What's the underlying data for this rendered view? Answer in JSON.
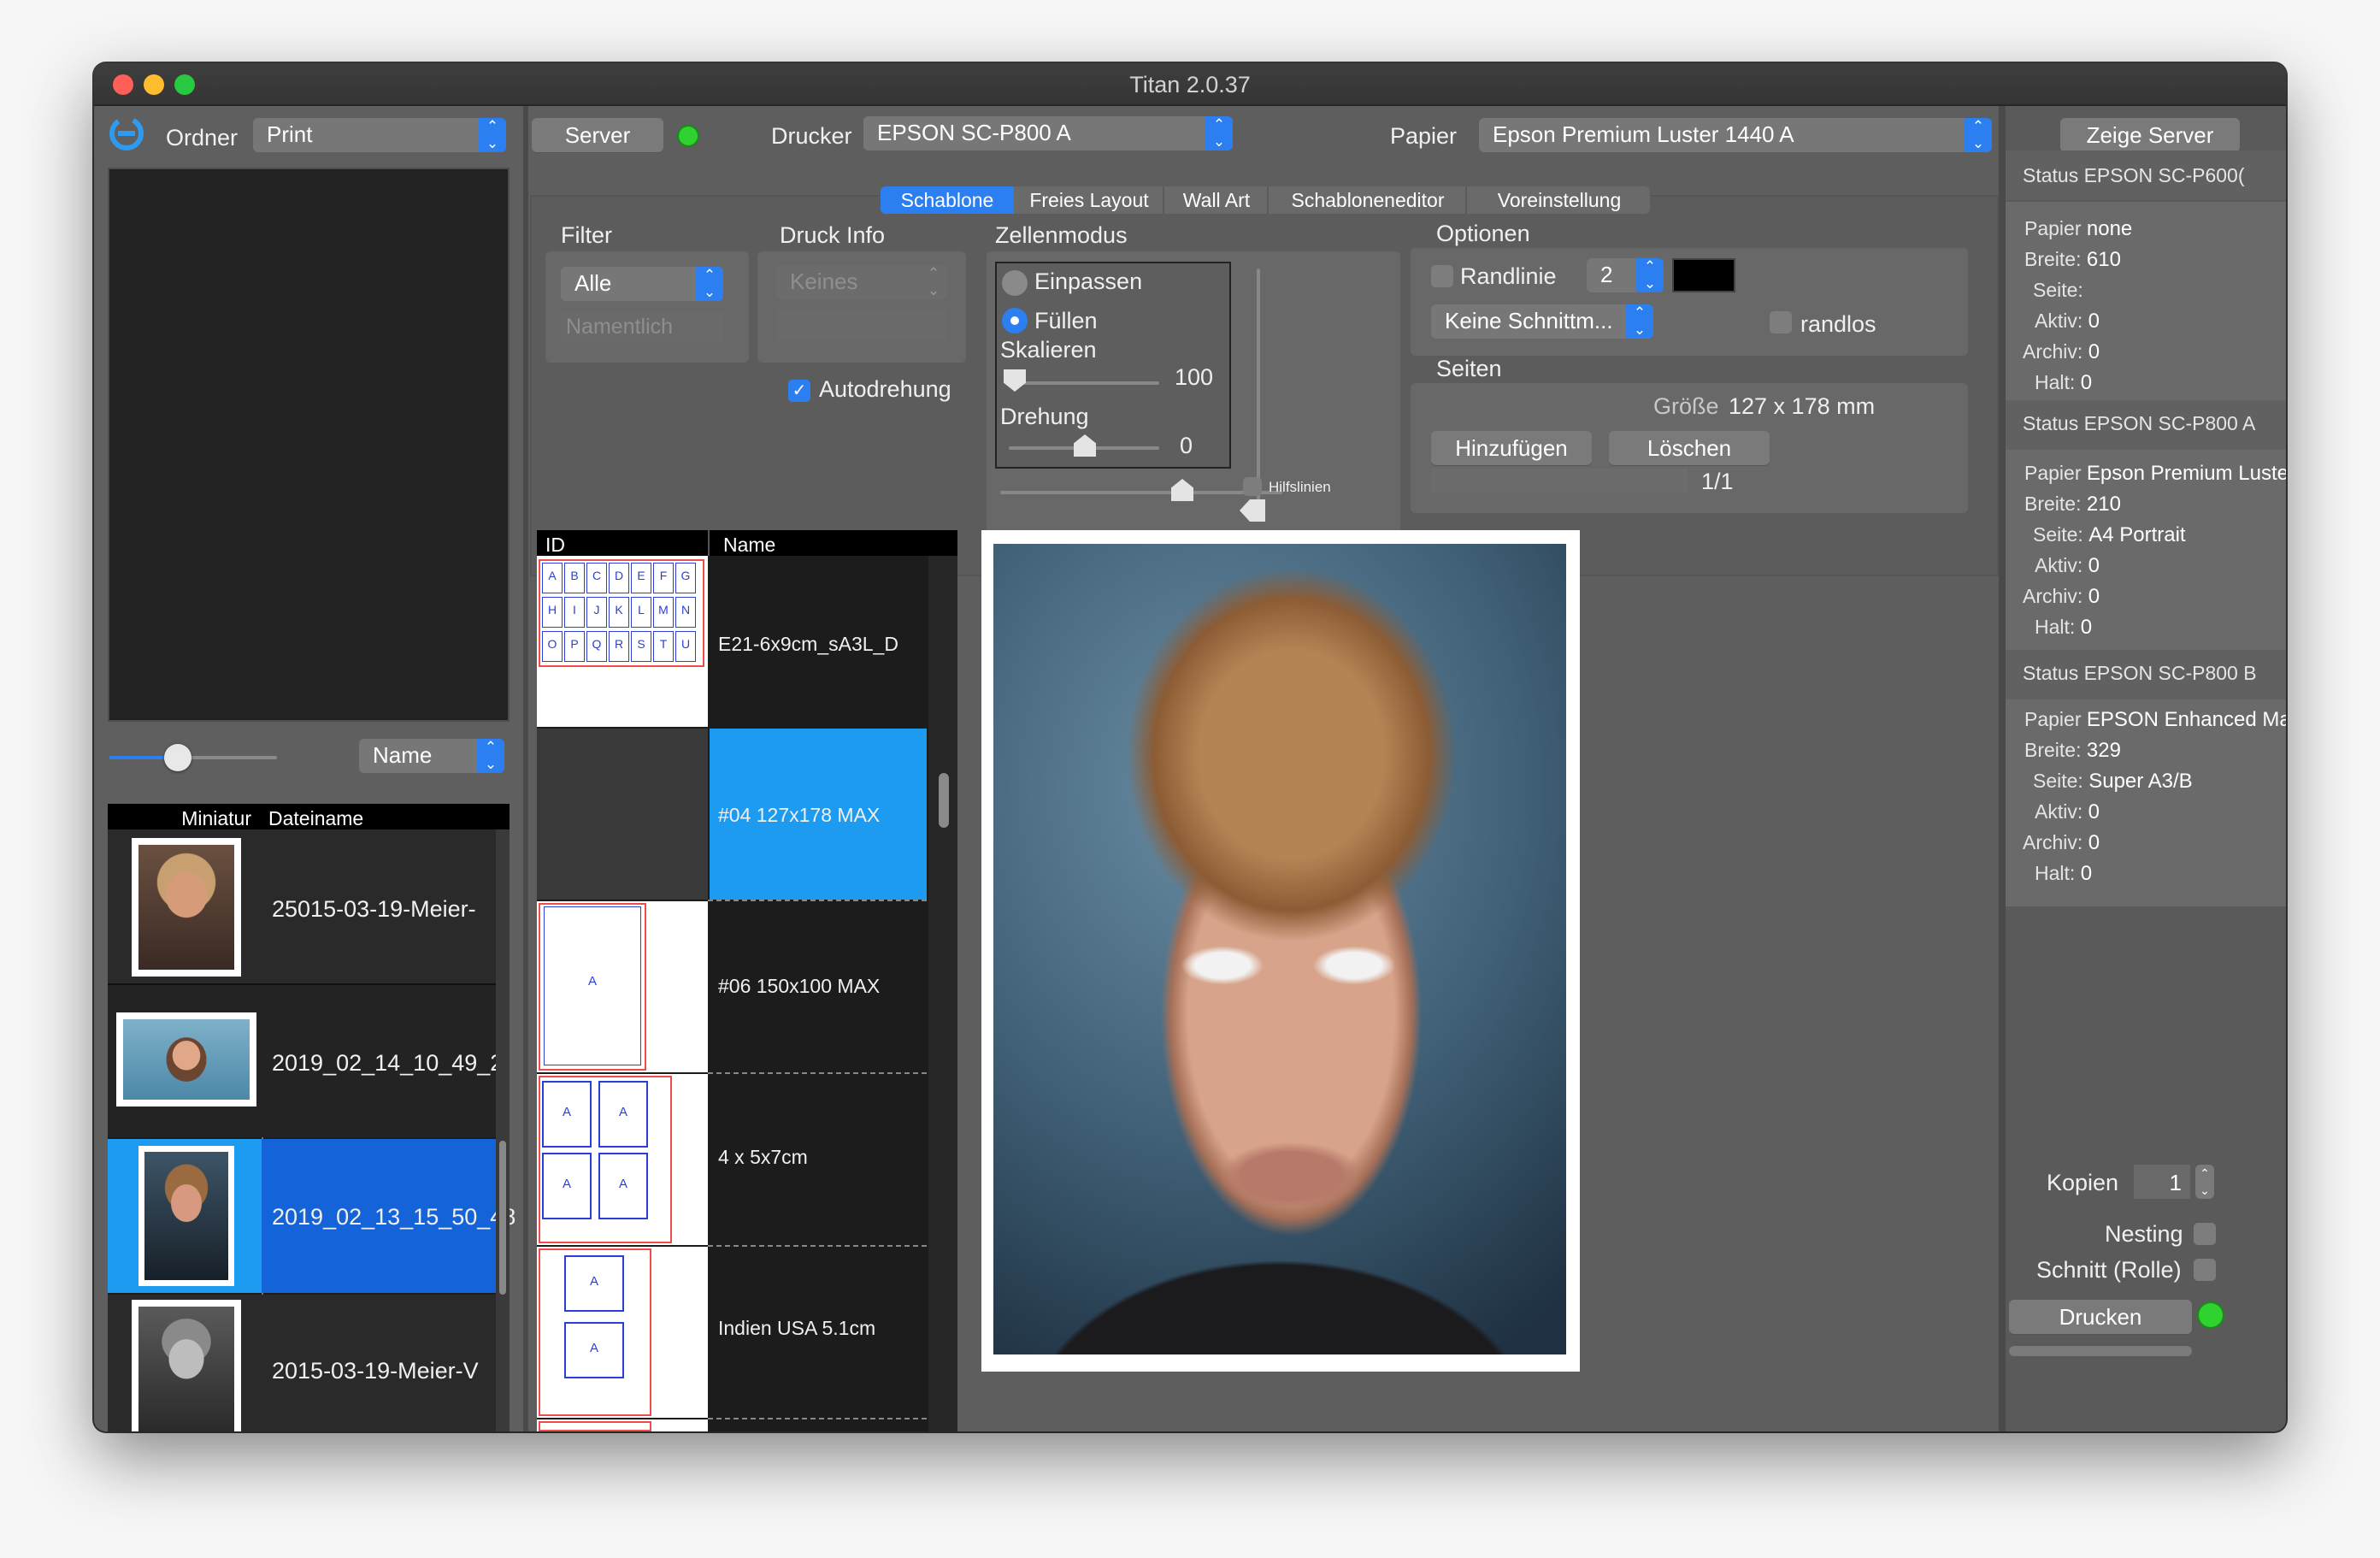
{
  "window": {
    "title": "Titan 2.0.37"
  },
  "left_panel": {
    "folder_label": "Ordner",
    "folder_value": "Print",
    "sort_value": "Name",
    "table_headers": [
      "Miniatur",
      "Dateiname"
    ],
    "files": [
      {
        "name": "25015-03-19-Meier-"
      },
      {
        "name": "2019_02_14_10_49_2!"
      },
      {
        "name": "2019_02_13_15_50_48"
      },
      {
        "name": "2015-03-19-Meier-V"
      }
    ]
  },
  "toolbar": {
    "server_button": "Server",
    "printer_label": "Drucker",
    "printer_value": "EPSON SC-P800 A",
    "paper_label": "Papier",
    "paper_value": "Epson Premium Luster 1440 A",
    "show_server_button": "Zeige Server"
  },
  "tabs": [
    "Schablone",
    "Freies Layout",
    "Wall Art",
    "Schabloneneditor",
    "Voreinstellung"
  ],
  "filter": {
    "title": "Filter",
    "value": "Alle",
    "name_placeholder": "Namentlich"
  },
  "print_info": {
    "title": "Druck Info",
    "value": "Keines",
    "autorotate_label": "Autodrehung"
  },
  "cell_mode": {
    "title": "Zellenmodus",
    "fit_label": "Einpassen",
    "fill_label": "Füllen",
    "scale_label": "Skalieren",
    "scale_value": "100",
    "rotation_label": "Drehung",
    "rotation_value": "0",
    "guides_label": "Hilfslinien"
  },
  "options": {
    "title": "Optionen",
    "border_label": "Randlinie",
    "border_width": "2",
    "border_color": "#000000",
    "cut_value": "Keine Schnittm...",
    "borderless_label": "randlos"
  },
  "pages": {
    "title": "Seiten",
    "size_label": "Größe",
    "size_value": "127 x 178 mm",
    "add_button": "Hinzufügen",
    "delete_button": "Löschen",
    "page_indicator": "1/1"
  },
  "template_list": {
    "headers": [
      "ID",
      "Name"
    ],
    "rows": [
      {
        "name": "E21-6x9cm_sA3L_D"
      },
      {
        "name": "#04 127x178 MAX"
      },
      {
        "name": "#06 150x100 MAX"
      },
      {
        "name": "4 x 5x7cm"
      },
      {
        "name": "Indien USA 5.1cm"
      }
    ],
    "grid_letters_row1": [
      "A",
      "B",
      "C",
      "D",
      "E",
      "F",
      "G"
    ],
    "grid_letters_row2": [
      "H",
      "I",
      "J",
      "K",
      "L",
      "M",
      "N"
    ],
    "grid_letters_row3": [
      "O",
      "P",
      "Q",
      "R",
      "S",
      "T",
      "U"
    ],
    "cell_letter": "A"
  },
  "status": [
    {
      "title": "Status EPSON SC-P600(",
      "paper_label": "Papier",
      "paper": "none",
      "width_label": "Breite:",
      "width": "610",
      "page_label": "Seite:",
      "page": "",
      "active_label": "Aktiv:",
      "active": "0",
      "archive_label": "Archiv:",
      "archive": "0",
      "hold_label": "Halt:",
      "hold": "0"
    },
    {
      "title": "Status EPSON SC-P800 A",
      "paper_label": "Papier",
      "paper": "Epson Premium Luste",
      "width_label": "Breite:",
      "width": "210",
      "page_label": "Seite:",
      "page": "A4 Portrait",
      "active_label": "Aktiv:",
      "active": "0",
      "archive_label": "Archiv:",
      "archive": "0",
      "hold_label": "Halt:",
      "hold": "0"
    },
    {
      "title": "Status EPSON SC-P800 B",
      "paper_label": "Papier",
      "paper": "EPSON Enhanced Ma",
      "width_label": "Breite:",
      "width": "329",
      "page_label": "Seite:",
      "page": "Super A3/B",
      "active_label": "Aktiv:",
      "active": "0",
      "archive_label": "Archiv:",
      "archive": "0",
      "hold_label": "Halt:",
      "hold": "0"
    }
  ],
  "print_controls": {
    "copies_label": "Kopien",
    "copies_value": "1",
    "nesting_label": "Nesting",
    "roll_cut_label": "Schnitt (Rolle)",
    "print_button": "Drucken"
  },
  "colors": {
    "accent": "#2c7ff0",
    "selection_light": "#1d9bf0",
    "selection_dark": "#1463d8",
    "status_ok": "#2fd22f"
  }
}
